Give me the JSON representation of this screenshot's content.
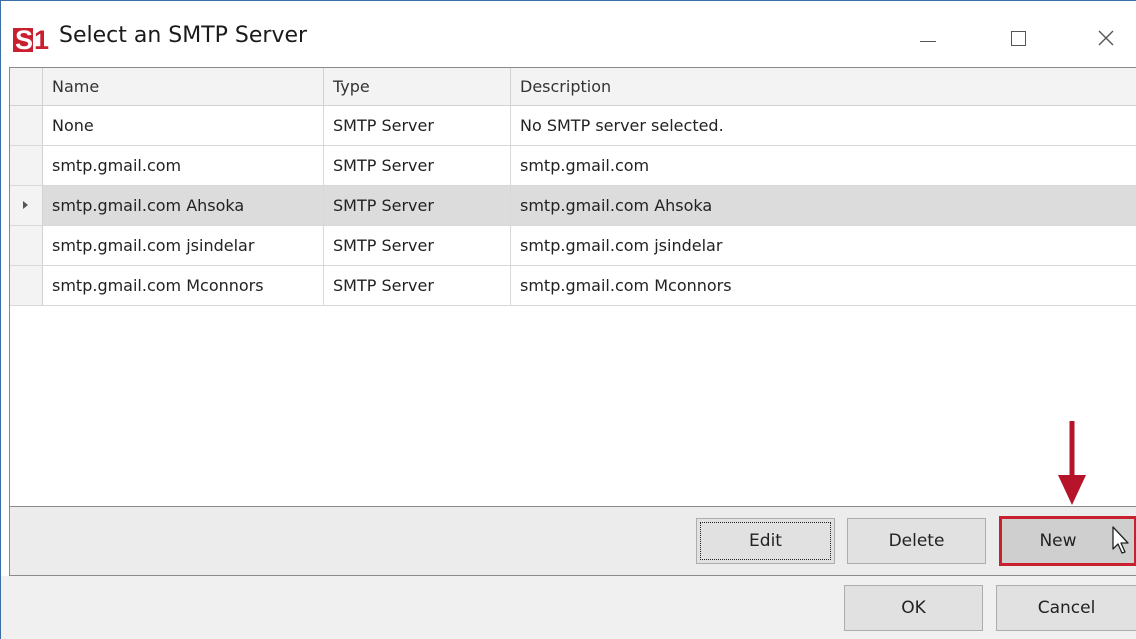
{
  "window": {
    "title": "Select an SMTP Server",
    "logo_text": "S1",
    "controls": [
      "minimize",
      "maximize",
      "close"
    ]
  },
  "grid": {
    "columns": [
      "Name",
      "Type",
      "Description"
    ],
    "rows": [
      {
        "name": "None",
        "type": "SMTP Server",
        "description": "No SMTP server selected.",
        "selected": false
      },
      {
        "name": "smtp.gmail.com",
        "type": "SMTP Server",
        "description": "smtp.gmail.com",
        "selected": false
      },
      {
        "name": "smtp.gmail.com Ahsoka",
        "type": "SMTP Server",
        "description": "smtp.gmail.com Ahsoka",
        "selected": true
      },
      {
        "name": "smtp.gmail.com jsindelar",
        "type": "SMTP Server",
        "description": "smtp.gmail.com jsindelar",
        "selected": false
      },
      {
        "name": "smtp.gmail.com Mconnors",
        "type": "SMTP Server",
        "description": "smtp.gmail.com Mconnors",
        "selected": false
      }
    ]
  },
  "toolbar": {
    "edit_label": "Edit",
    "delete_label": "Delete",
    "new_label": "New"
  },
  "footer": {
    "ok_label": "OK",
    "cancel_label": "Cancel"
  },
  "colors": {
    "brand_red": "#c8202f",
    "selected_row": "#dcdcdc",
    "annotation": "#b5142a"
  },
  "icons": {
    "logo": "s1-logo-icon",
    "minimize": "minimize-icon",
    "maximize": "maximize-icon",
    "close": "close-icon",
    "row_indicator": "row-indicator-arrow-icon",
    "annotation": "down-arrow-annotation-icon",
    "cursor": "mouse-cursor-icon"
  }
}
